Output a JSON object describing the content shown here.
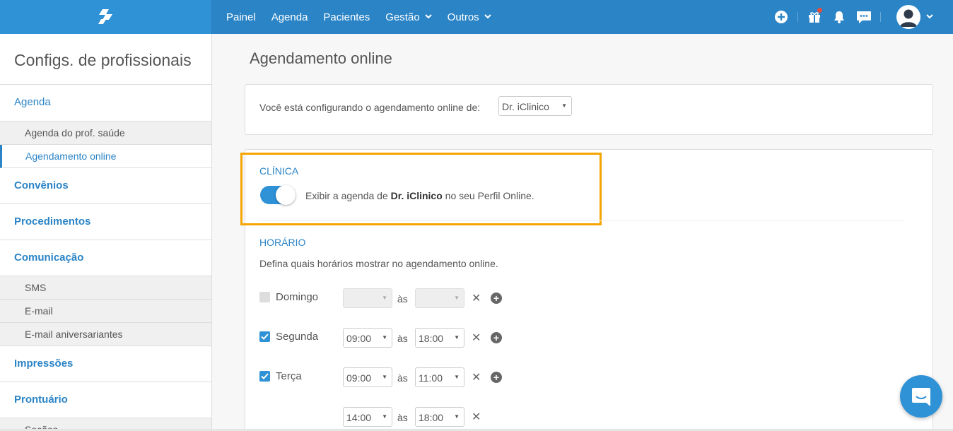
{
  "colors": {
    "primary": "#2b84c6",
    "highlight": "#f5a500"
  },
  "topbar": {
    "nav": [
      {
        "label": "Painel"
      },
      {
        "label": "Agenda"
      },
      {
        "label": "Pacientes"
      },
      {
        "label": "Gestão",
        "dropdown": true
      },
      {
        "label": "Outros",
        "dropdown": true
      }
    ],
    "icons": [
      "plus-circle-icon",
      "gift-icon",
      "bell-icon",
      "chat-icon",
      "user-avatar-icon"
    ]
  },
  "sidebar": {
    "title": "Configs. de profissionais",
    "agenda": "Agenda",
    "agenda_prof": "Agenda do prof. saúde",
    "agendamento_online": "Agendamento online",
    "convenios": "Convênios",
    "procedimentos": "Procedimentos",
    "comunicacao": "Comunicação",
    "sms": "SMS",
    "email": "E-mail",
    "email_aniv": "E-mail aniversariantes",
    "impressoes": "Impressões",
    "prontuario": "Prontuário",
    "secoes": "Seções"
  },
  "main": {
    "title": "Agendamento online",
    "config_label": "Você está configurando o agendamento online de:",
    "professional": "Dr. iClinico",
    "clinica_head": "CLÍNICA",
    "toggle_pre": "Exibir a agenda de ",
    "toggle_name": "Dr. iClinico",
    "toggle_post": " no seu Perfil Online.",
    "toggle_on": true,
    "horario_head": "HORÁRIO",
    "horario_desc": "Defina quais horários mostrar no agendamento online.",
    "as_label": "às",
    "days": [
      {
        "name": "Domingo",
        "checked": false,
        "start": "",
        "end": ""
      },
      {
        "name": "Segunda",
        "checked": true,
        "start": "09:00",
        "end": "18:00"
      },
      {
        "name": "Terça",
        "checked": true,
        "start": "09:00",
        "end": "11:00"
      },
      {
        "name": "",
        "checked": null,
        "start": "14:00",
        "end": "18:00"
      }
    ]
  }
}
